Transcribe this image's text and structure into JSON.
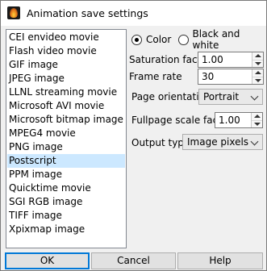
{
  "window": {
    "title": "Animation save settings"
  },
  "formats": [
    {
      "label": "CEI envideo movie",
      "selected": false
    },
    {
      "label": "Flash video movie",
      "selected": false
    },
    {
      "label": "GIF image",
      "selected": false
    },
    {
      "label": "JPEG image",
      "selected": false
    },
    {
      "label": "LLNL streaming movie",
      "selected": false
    },
    {
      "label": "Microsoft AVI movie",
      "selected": false
    },
    {
      "label": "Microsoft bitmap image",
      "selected": false
    },
    {
      "label": "MPEG4 movie",
      "selected": false
    },
    {
      "label": "PNG image",
      "selected": false
    },
    {
      "label": "Postscript",
      "selected": true
    },
    {
      "label": "PPM image",
      "selected": false
    },
    {
      "label": "Quicktime movie",
      "selected": false
    },
    {
      "label": "SGI RGB image",
      "selected": false
    },
    {
      "label": "TIFF image",
      "selected": false
    },
    {
      "label": "Xpixmap image",
      "selected": false
    }
  ],
  "color_mode": {
    "color_label": "Color",
    "bw_label": "Black and white",
    "selected": "color"
  },
  "saturation": {
    "label": "Saturation factor",
    "value": "1.00"
  },
  "frame_rate": {
    "label": "Frame rate",
    "value": "30"
  },
  "page_orientation": {
    "label": "Page orientation",
    "value": "Portrait"
  },
  "fullpage_scale": {
    "label": "Fullpage scale factor",
    "value": "1.00"
  },
  "output_type": {
    "label": "Output type",
    "value": "Image pixels"
  },
  "buttons": {
    "ok": "OK",
    "cancel": "Cancel",
    "help": "Help"
  }
}
